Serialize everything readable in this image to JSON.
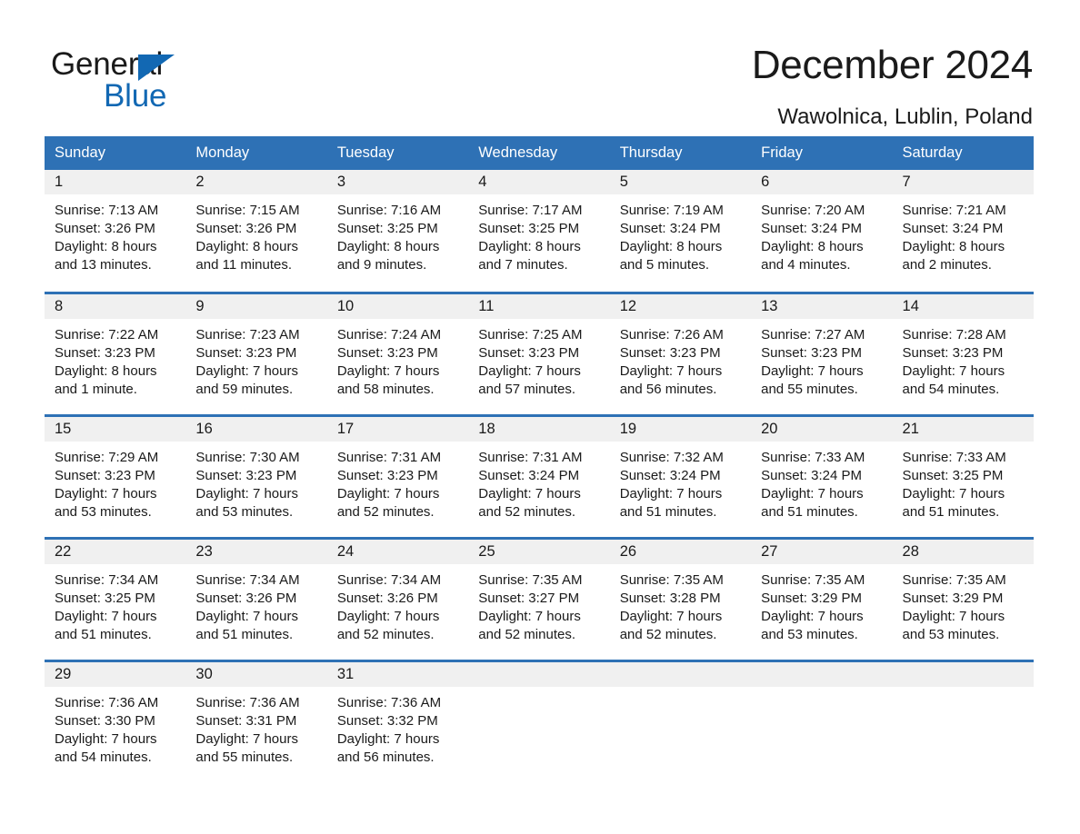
{
  "brand": {
    "name_part1": "General",
    "name_part2": "Blue",
    "triangle_color": "#1268b3"
  },
  "header": {
    "title": "December 2024",
    "subtitle": "Wawolnica, Lublin, Poland"
  },
  "theme": {
    "header_blue": "#2e71b5",
    "daynum_band": "#f0f0f0",
    "text": "#1a1a1a"
  },
  "calendar": {
    "weekday_headers": [
      "Sunday",
      "Monday",
      "Tuesday",
      "Wednesday",
      "Thursday",
      "Friday",
      "Saturday"
    ],
    "weeks": [
      [
        {
          "day": "1",
          "sunrise": "Sunrise: 7:13 AM",
          "sunset": "Sunset: 3:26 PM",
          "daylight_line1": "Daylight: 8 hours",
          "daylight_line2": "and 13 minutes."
        },
        {
          "day": "2",
          "sunrise": "Sunrise: 7:15 AM",
          "sunset": "Sunset: 3:26 PM",
          "daylight_line1": "Daylight: 8 hours",
          "daylight_line2": "and 11 minutes."
        },
        {
          "day": "3",
          "sunrise": "Sunrise: 7:16 AM",
          "sunset": "Sunset: 3:25 PM",
          "daylight_line1": "Daylight: 8 hours",
          "daylight_line2": "and 9 minutes."
        },
        {
          "day": "4",
          "sunrise": "Sunrise: 7:17 AM",
          "sunset": "Sunset: 3:25 PM",
          "daylight_line1": "Daylight: 8 hours",
          "daylight_line2": "and 7 minutes."
        },
        {
          "day": "5",
          "sunrise": "Sunrise: 7:19 AM",
          "sunset": "Sunset: 3:24 PM",
          "daylight_line1": "Daylight: 8 hours",
          "daylight_line2": "and 5 minutes."
        },
        {
          "day": "6",
          "sunrise": "Sunrise: 7:20 AM",
          "sunset": "Sunset: 3:24 PM",
          "daylight_line1": "Daylight: 8 hours",
          "daylight_line2": "and 4 minutes."
        },
        {
          "day": "7",
          "sunrise": "Sunrise: 7:21 AM",
          "sunset": "Sunset: 3:24 PM",
          "daylight_line1": "Daylight: 8 hours",
          "daylight_line2": "and 2 minutes."
        }
      ],
      [
        {
          "day": "8",
          "sunrise": "Sunrise: 7:22 AM",
          "sunset": "Sunset: 3:23 PM",
          "daylight_line1": "Daylight: 8 hours",
          "daylight_line2": "and 1 minute."
        },
        {
          "day": "9",
          "sunrise": "Sunrise: 7:23 AM",
          "sunset": "Sunset: 3:23 PM",
          "daylight_line1": "Daylight: 7 hours",
          "daylight_line2": "and 59 minutes."
        },
        {
          "day": "10",
          "sunrise": "Sunrise: 7:24 AM",
          "sunset": "Sunset: 3:23 PM",
          "daylight_line1": "Daylight: 7 hours",
          "daylight_line2": "and 58 minutes."
        },
        {
          "day": "11",
          "sunrise": "Sunrise: 7:25 AM",
          "sunset": "Sunset: 3:23 PM",
          "daylight_line1": "Daylight: 7 hours",
          "daylight_line2": "and 57 minutes."
        },
        {
          "day": "12",
          "sunrise": "Sunrise: 7:26 AM",
          "sunset": "Sunset: 3:23 PM",
          "daylight_line1": "Daylight: 7 hours",
          "daylight_line2": "and 56 minutes."
        },
        {
          "day": "13",
          "sunrise": "Sunrise: 7:27 AM",
          "sunset": "Sunset: 3:23 PM",
          "daylight_line1": "Daylight: 7 hours",
          "daylight_line2": "and 55 minutes."
        },
        {
          "day": "14",
          "sunrise": "Sunrise: 7:28 AM",
          "sunset": "Sunset: 3:23 PM",
          "daylight_line1": "Daylight: 7 hours",
          "daylight_line2": "and 54 minutes."
        }
      ],
      [
        {
          "day": "15",
          "sunrise": "Sunrise: 7:29 AM",
          "sunset": "Sunset: 3:23 PM",
          "daylight_line1": "Daylight: 7 hours",
          "daylight_line2": "and 53 minutes."
        },
        {
          "day": "16",
          "sunrise": "Sunrise: 7:30 AM",
          "sunset": "Sunset: 3:23 PM",
          "daylight_line1": "Daylight: 7 hours",
          "daylight_line2": "and 53 minutes."
        },
        {
          "day": "17",
          "sunrise": "Sunrise: 7:31 AM",
          "sunset": "Sunset: 3:23 PM",
          "daylight_line1": "Daylight: 7 hours",
          "daylight_line2": "and 52 minutes."
        },
        {
          "day": "18",
          "sunrise": "Sunrise: 7:31 AM",
          "sunset": "Sunset: 3:24 PM",
          "daylight_line1": "Daylight: 7 hours",
          "daylight_line2": "and 52 minutes."
        },
        {
          "day": "19",
          "sunrise": "Sunrise: 7:32 AM",
          "sunset": "Sunset: 3:24 PM",
          "daylight_line1": "Daylight: 7 hours",
          "daylight_line2": "and 51 minutes."
        },
        {
          "day": "20",
          "sunrise": "Sunrise: 7:33 AM",
          "sunset": "Sunset: 3:24 PM",
          "daylight_line1": "Daylight: 7 hours",
          "daylight_line2": "and 51 minutes."
        },
        {
          "day": "21",
          "sunrise": "Sunrise: 7:33 AM",
          "sunset": "Sunset: 3:25 PM",
          "daylight_line1": "Daylight: 7 hours",
          "daylight_line2": "and 51 minutes."
        }
      ],
      [
        {
          "day": "22",
          "sunrise": "Sunrise: 7:34 AM",
          "sunset": "Sunset: 3:25 PM",
          "daylight_line1": "Daylight: 7 hours",
          "daylight_line2": "and 51 minutes."
        },
        {
          "day": "23",
          "sunrise": "Sunrise: 7:34 AM",
          "sunset": "Sunset: 3:26 PM",
          "daylight_line1": "Daylight: 7 hours",
          "daylight_line2": "and 51 minutes."
        },
        {
          "day": "24",
          "sunrise": "Sunrise: 7:34 AM",
          "sunset": "Sunset: 3:26 PM",
          "daylight_line1": "Daylight: 7 hours",
          "daylight_line2": "and 52 minutes."
        },
        {
          "day": "25",
          "sunrise": "Sunrise: 7:35 AM",
          "sunset": "Sunset: 3:27 PM",
          "daylight_line1": "Daylight: 7 hours",
          "daylight_line2": "and 52 minutes."
        },
        {
          "day": "26",
          "sunrise": "Sunrise: 7:35 AM",
          "sunset": "Sunset: 3:28 PM",
          "daylight_line1": "Daylight: 7 hours",
          "daylight_line2": "and 52 minutes."
        },
        {
          "day": "27",
          "sunrise": "Sunrise: 7:35 AM",
          "sunset": "Sunset: 3:29 PM",
          "daylight_line1": "Daylight: 7 hours",
          "daylight_line2": "and 53 minutes."
        },
        {
          "day": "28",
          "sunrise": "Sunrise: 7:35 AM",
          "sunset": "Sunset: 3:29 PM",
          "daylight_line1": "Daylight: 7 hours",
          "daylight_line2": "and 53 minutes."
        }
      ],
      [
        {
          "day": "29",
          "sunrise": "Sunrise: 7:36 AM",
          "sunset": "Sunset: 3:30 PM",
          "daylight_line1": "Daylight: 7 hours",
          "daylight_line2": "and 54 minutes."
        },
        {
          "day": "30",
          "sunrise": "Sunrise: 7:36 AM",
          "sunset": "Sunset: 3:31 PM",
          "daylight_line1": "Daylight: 7 hours",
          "daylight_line2": "and 55 minutes."
        },
        {
          "day": "31",
          "sunrise": "Sunrise: 7:36 AM",
          "sunset": "Sunset: 3:32 PM",
          "daylight_line1": "Daylight: 7 hours",
          "daylight_line2": "and 56 minutes."
        },
        {
          "day": "",
          "sunrise": "",
          "sunset": "",
          "daylight_line1": "",
          "daylight_line2": ""
        },
        {
          "day": "",
          "sunrise": "",
          "sunset": "",
          "daylight_line1": "",
          "daylight_line2": ""
        },
        {
          "day": "",
          "sunrise": "",
          "sunset": "",
          "daylight_line1": "",
          "daylight_line2": ""
        },
        {
          "day": "",
          "sunrise": "",
          "sunset": "",
          "daylight_line1": "",
          "daylight_line2": ""
        }
      ]
    ]
  }
}
